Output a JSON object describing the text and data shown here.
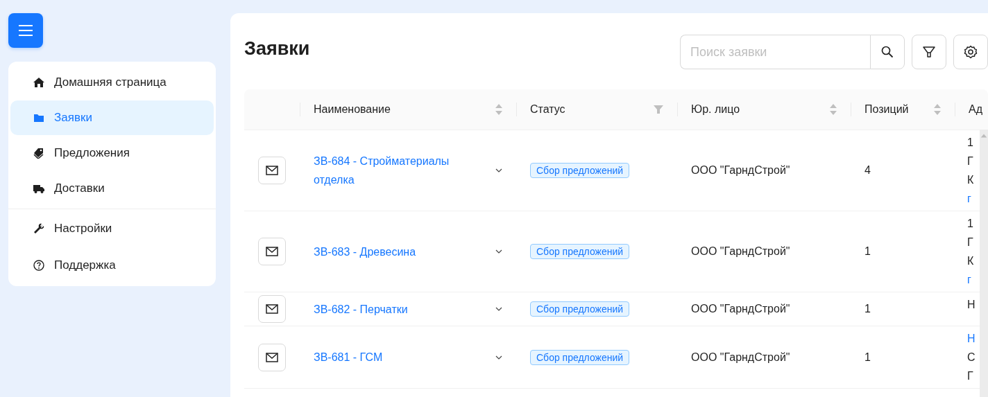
{
  "nav": [
    {
      "kind": "home",
      "label": "Домашняя страница",
      "selected": false,
      "divider_before": false
    },
    {
      "kind": "folder",
      "label": "Заявки",
      "selected": true,
      "divider_before": false
    },
    {
      "kind": "tags",
      "label": "Предложения",
      "selected": false,
      "divider_before": false
    },
    {
      "kind": "truck",
      "label": "Доставки",
      "selected": false,
      "divider_before": false
    },
    {
      "kind": "wrench",
      "label": "Настройки",
      "selected": false,
      "divider_before": true
    },
    {
      "kind": "help",
      "label": "Поддержка",
      "selected": false,
      "divider_before": false
    }
  ],
  "page": {
    "title": "Заявки",
    "search": {
      "placeholder": "Поиск заявки"
    }
  },
  "table": {
    "columns": [
      {
        "label": "Наименование",
        "kind": "sort"
      },
      {
        "label": "Статус",
        "kind": "filter"
      },
      {
        "label": "Юр. лицо",
        "kind": "sort"
      },
      {
        "label": "Позиций",
        "kind": "sort"
      },
      {
        "label": "Ад",
        "kind": "none"
      }
    ],
    "rows": [
      {
        "name": "ЗВ-684 - Стройматериалы отделка",
        "status": "Сбор предложений",
        "entity": "ООО \"ГарндСтрой\"",
        "positions": "4",
        "address": [
          {
            "text": "1",
            "link": false
          },
          {
            "text": "Г",
            "link": false
          },
          {
            "text": "К",
            "link": false
          },
          {
            "text": "г",
            "link": true
          }
        ]
      },
      {
        "name": "ЗВ-683 - Древесина",
        "status": "Сбор предложений",
        "entity": "ООО \"ГарндСтрой\"",
        "positions": "1",
        "address": [
          {
            "text": "1",
            "link": false
          },
          {
            "text": "Г",
            "link": false
          },
          {
            "text": "К",
            "link": false
          },
          {
            "text": "г",
            "link": true
          }
        ]
      },
      {
        "name": "ЗВ-682 - Перчатки",
        "status": "Сбор предложений",
        "entity": "ООО \"ГарндСтрой\"",
        "positions": "1",
        "address": [
          {
            "text": "Н",
            "link": false
          }
        ]
      },
      {
        "name": "ЗВ-681 - ГСМ",
        "status": "Сбор предложений",
        "entity": "ООО \"ГарндСтрой\"",
        "positions": "1",
        "address": [
          {
            "text": "Н",
            "link": true
          },
          {
            "text": "С",
            "link": false
          },
          {
            "text": "Г",
            "link": false
          }
        ]
      }
    ]
  }
}
